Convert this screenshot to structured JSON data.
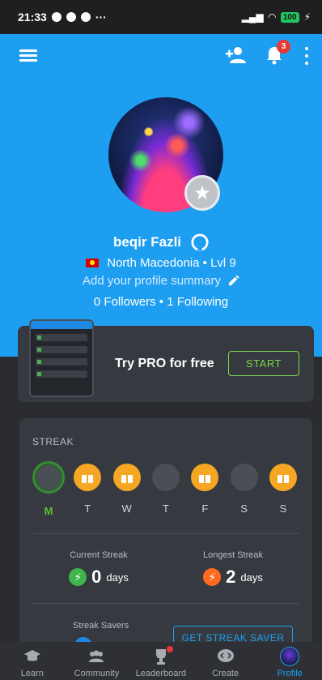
{
  "statusbar": {
    "time": "21:33",
    "battery": "100"
  },
  "header": {
    "notification_count": "3",
    "name": "beqir Fazli",
    "country_level": "North Macedonia • Lvl 9",
    "summary_placeholder": "Add your profile summary",
    "follow": "0 Followers • 1 Following"
  },
  "pro": {
    "title": "Try PRO for free",
    "start_label": "START"
  },
  "streak": {
    "title": "STREAK",
    "days": [
      {
        "label": "M",
        "state": "current"
      },
      {
        "label": "T",
        "state": "gift"
      },
      {
        "label": "W",
        "state": "gift"
      },
      {
        "label": "T",
        "state": "empty"
      },
      {
        "label": "F",
        "state": "gift"
      },
      {
        "label": "S",
        "state": "empty"
      },
      {
        "label": "S",
        "state": "gift"
      }
    ],
    "current_label": "Current Streak",
    "current_value": "0",
    "current_unit": "days",
    "longest_label": "Longest Streak",
    "longest_value": "2",
    "longest_unit": "days",
    "savers_label": "Streak Savers",
    "get_saver_label": "GET STREAK SAVER"
  },
  "nav": {
    "items": [
      {
        "label": "Learn",
        "icon": "graduation-cap-icon"
      },
      {
        "label": "Community",
        "icon": "people-icon"
      },
      {
        "label": "Leaderboard",
        "icon": "trophy-icon"
      },
      {
        "label": "Create",
        "icon": "code-bubble-icon"
      },
      {
        "label": "Profile",
        "icon": "avatar"
      }
    ]
  },
  "colors": {
    "accent": "#1e9ef0",
    "green": "#7bd44b",
    "orange": "#f5a623"
  }
}
